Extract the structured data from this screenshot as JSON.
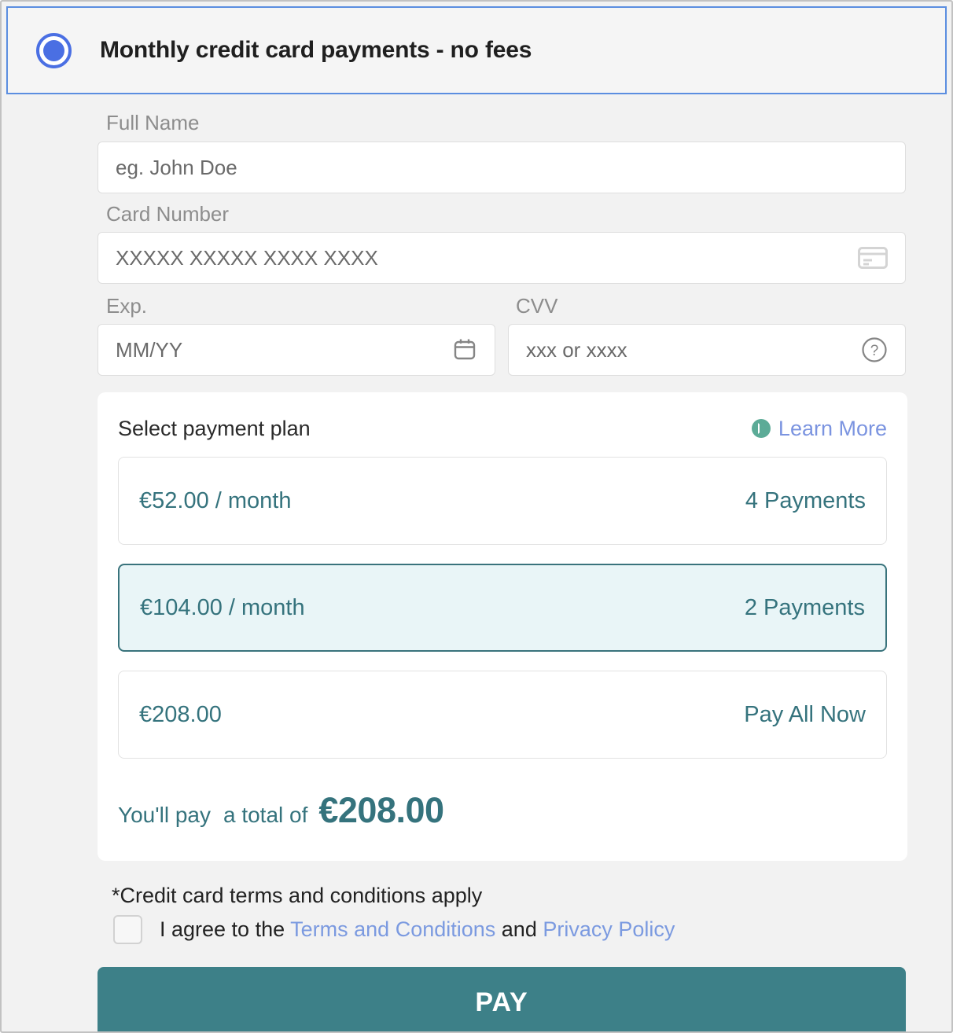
{
  "header": {
    "title": "Monthly credit card payments - no fees",
    "radio_selected": true,
    "accent_color": "#4a6fe3"
  },
  "form": {
    "full_name": {
      "label": "Full Name",
      "placeholder": "eg. John Doe",
      "value": ""
    },
    "card_number": {
      "label": "Card Number",
      "placeholder": "XXXXX XXXXX XXXX XXXX",
      "value": "",
      "icon": "credit-card-icon"
    },
    "expiry": {
      "label": "Exp.",
      "placeholder": "MM/YY",
      "value": "",
      "icon": "calendar-icon"
    },
    "cvv": {
      "label": "CVV",
      "placeholder": "xxx or xxxx",
      "value": "",
      "icon": "help-circle-icon"
    }
  },
  "plan_panel": {
    "title": "Select payment plan",
    "learn_more": {
      "label": "Learn More",
      "icon": "chevron-circle-icon",
      "icon_color": "#5cab97",
      "text_color": "#7b94e0"
    },
    "options": [
      {
        "amount": "€52.00 / month",
        "count": "4 Payments",
        "selected": false
      },
      {
        "amount": "€104.00 / month",
        "count": "2 Payments",
        "selected": true
      },
      {
        "amount": "€208.00",
        "count": "Pay All Now",
        "selected": false
      }
    ],
    "total": {
      "prefix": "You'll pay",
      "middle": "a total of",
      "value": "€208.00"
    },
    "accent_color": "#35737d",
    "selected_bg": "#e9f5f7"
  },
  "terms": {
    "note": "*Credit card terms and conditions apply",
    "agree_prefix": "I agree to the ",
    "terms_link": "Terms and Conditions",
    "agree_middle": " and ",
    "privacy_link": "Privacy Policy",
    "checked": false
  },
  "pay_button": {
    "label": "PAY",
    "color": "#3d8088"
  }
}
